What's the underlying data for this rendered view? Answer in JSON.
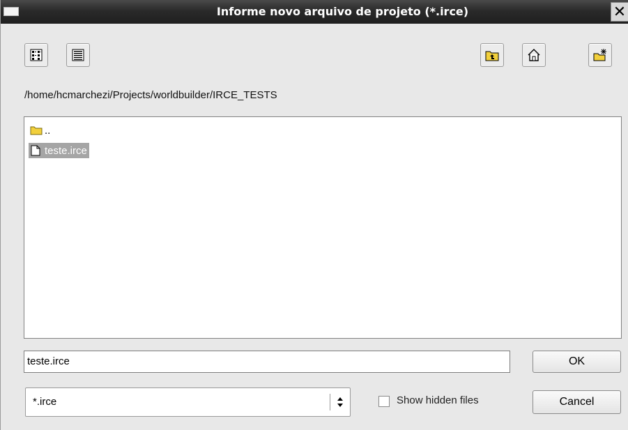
{
  "window": {
    "title": "Informe novo arquivo de projeto (*.irce)",
    "close_glyph": "✕"
  },
  "toolbar": {
    "left_buttons": [
      {
        "name": "icon-view-button",
        "icon": "icon-view-icon"
      },
      {
        "name": "detail-view-button",
        "icon": "detail-view-icon"
      }
    ],
    "right_buttons": [
      {
        "name": "parent-folder-button",
        "icon": "folder-up-icon"
      },
      {
        "name": "home-button",
        "icon": "home-icon"
      },
      {
        "name": "new-folder-button",
        "icon": "new-folder-icon"
      }
    ]
  },
  "path": "/home/hcmarchezi/Projects/worldbuilder/IRCE_TESTS",
  "files": [
    {
      "label": "..",
      "type": "folder",
      "selected": false
    },
    {
      "label": "teste.irce",
      "type": "file",
      "selected": true
    }
  ],
  "filename": {
    "value": "teste.irce"
  },
  "buttons": {
    "ok": "OK",
    "cancel": "Cancel"
  },
  "filter": {
    "selected": "*.irce"
  },
  "show_hidden": {
    "label": "Show hidden files",
    "checked": false
  },
  "colors": {
    "titlebar": "#2a2a2a",
    "selection": "#a5a5a5",
    "folder": "#f2d03c"
  }
}
